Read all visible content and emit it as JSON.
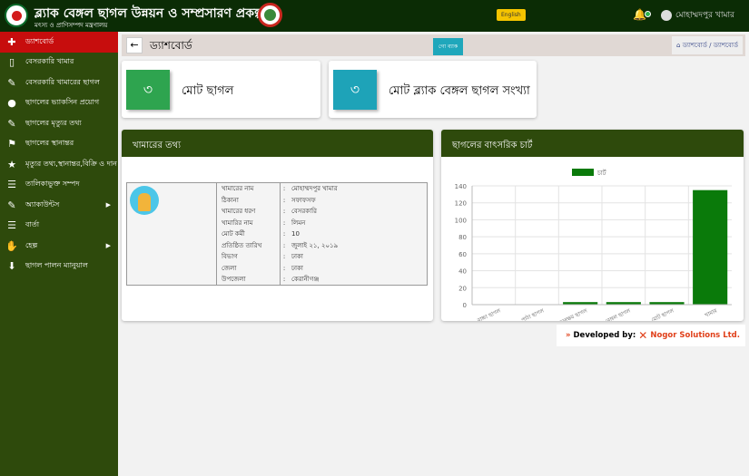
{
  "header": {
    "title": "ব্ল্যাক বেঙ্গল ছাগল উন্নয়ন ও সম্প্রসারণ প্রকল্প",
    "subtitle": "মৎস্য ও প্রাণিসম্পদ মন্ত্রণালয়",
    "language_button": "English",
    "user_name": "মোহাম্মদপুর খামার",
    "notification_icon": "bell-icon"
  },
  "sidebar": {
    "items": [
      {
        "label": "ড্যাশবোর্ড",
        "icon": "clipboard-icon",
        "active": true
      },
      {
        "label": "বেসরকারি খামার",
        "icon": "document-icon"
      },
      {
        "label": "বেসরকারি খামারের ছাগল",
        "icon": "edit-icon"
      },
      {
        "label": "ছাগলের ভ্যাকসিন প্রয়োগ",
        "icon": "pills-icon"
      },
      {
        "label": "ছাগলের মৃত্যুর তথ্য",
        "icon": "edit-icon"
      },
      {
        "label": "ছাগলের স্থানান্তর",
        "icon": "map-icon"
      },
      {
        "label": "মৃত্যুর তথ্য,স্থানান্তর,বিক্রি ও দান",
        "icon": "star-icon"
      },
      {
        "label": "তালিকাভুক্ত সম্পদ",
        "icon": "sliders-icon"
      },
      {
        "label": "অ্যাকাউন্টস",
        "icon": "edit-icon",
        "submenu": true
      },
      {
        "label": "বার্তা",
        "icon": "sliders-icon"
      },
      {
        "label": "হেল্প",
        "icon": "handshake-icon",
        "submenu": true
      },
      {
        "label": "ছাগল পালন ম্যানুয়াল",
        "icon": "download-icon"
      }
    ]
  },
  "topbar": {
    "title": "ড্যাশবোর্ড",
    "go_back": "গো ব্যাক",
    "breadcrumb": [
      "ড্যাশবোর্ড",
      "ড্যাশবোর্ড"
    ]
  },
  "stats": [
    {
      "value": "৩",
      "label": "মোট ছাগল",
      "color": "#2ea44f"
    },
    {
      "value": "৩",
      "label": "মোট ব্ল্যাক বেঙ্গল ছাগল সংখ্যা",
      "color": "#1ea3b8"
    }
  ],
  "farm_info": {
    "title": "খামারের তথ্য",
    "rows": [
      {
        "label": "খামারের নাম",
        "value": "মোহাম্মদপুর খামার"
      },
      {
        "label": "ঠিকানা",
        "value": "সফাফসফ"
      },
      {
        "label": "খামারের ধরণ",
        "value": "বেসরকারি"
      },
      {
        "label": "খামারির নাম",
        "value": "লিমন"
      },
      {
        "label": "মোট কর্মী",
        "value": "10"
      },
      {
        "label": "প্রতিষ্ঠিত তারিখ",
        "value": "জুলাই ২১, ২০১৯"
      },
      {
        "label": "বিভাগ",
        "value": "ঢাকা"
      },
      {
        "label": "জেলা",
        "value": "ঢাকা"
      },
      {
        "label": "উপজেলা",
        "value": "কেরানীগঞ্জ"
      }
    ]
  },
  "chart_panel": {
    "title": "ছাগলের বাৎসরিক চার্ট"
  },
  "chart_data": {
    "type": "bar",
    "categories": [
      "বাচ্চা ছাগল",
      "পাঠা ছাগল",
      "প্রজননক্ষম ছাগল",
      "ব্ল্যাক বেঙ্গল ছাগল",
      "মোট ছাগল",
      "খামার"
    ],
    "series": [
      {
        "name": "চার্ট",
        "values": [
          0,
          0,
          3,
          3,
          3,
          135
        ],
        "color": "#0a7a0a"
      }
    ],
    "ylim": [
      0,
      140
    ],
    "yticks": [
      0,
      20,
      40,
      60,
      80,
      100,
      120,
      140
    ],
    "grid": true,
    "legend": "top"
  },
  "footer": {
    "prefix": "»",
    "text": "Developed by:",
    "company": "Nogor Solutions Ltd.",
    "color": "#e0401a"
  }
}
